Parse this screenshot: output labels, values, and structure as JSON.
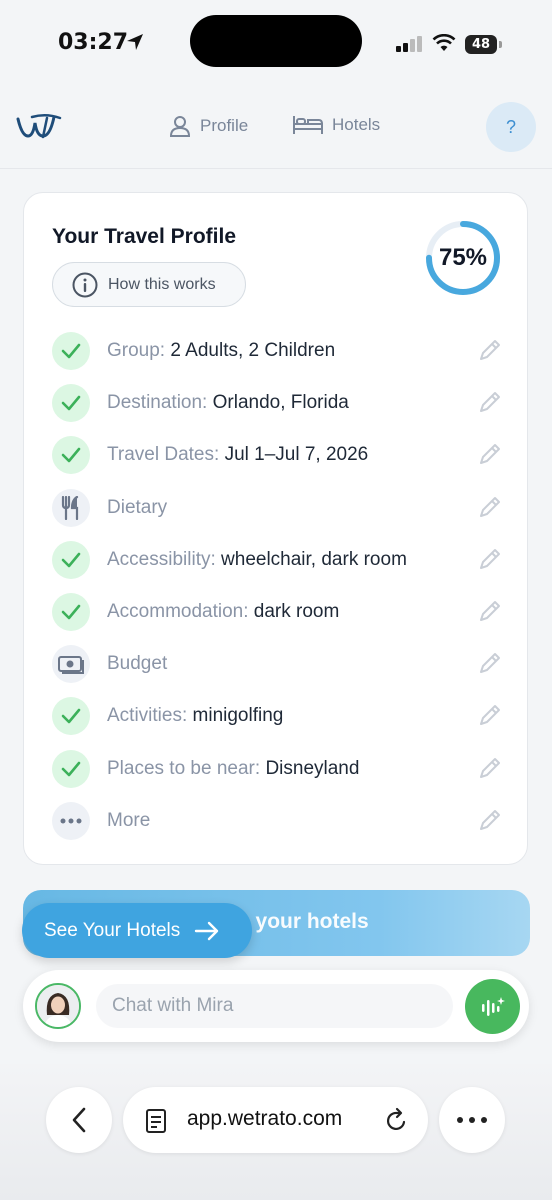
{
  "status": {
    "time": "03:27",
    "battery": "48"
  },
  "nav": {
    "profile_label": "Profile",
    "hotels_label": "Hotels",
    "help_label": "?"
  },
  "profile": {
    "title": "Your Travel Profile",
    "how_label": "How this works",
    "progress_percent": 75,
    "progress_label": "75%",
    "rows": [
      {
        "key": "Group:",
        "value": "2 Adults, 2 Children",
        "done": true,
        "icon": "check-icon"
      },
      {
        "key": "Destination:",
        "value": "Orlando, Florida",
        "done": true,
        "icon": "check-icon"
      },
      {
        "key": "Travel Dates:",
        "value": "Jul 1–Jul 7, 2026",
        "done": true,
        "icon": "check-icon"
      },
      {
        "key": "Dietary",
        "value": "",
        "done": false,
        "icon": "utensils-icon"
      },
      {
        "key": "Accessibility:",
        "value": "wheelchair, dark room",
        "done": true,
        "icon": "check-icon"
      },
      {
        "key": "Accommodation:",
        "value": "dark room",
        "done": true,
        "icon": "check-icon"
      },
      {
        "key": "Budget",
        "value": "",
        "done": false,
        "icon": "money-icon"
      },
      {
        "key": "Activities:",
        "value": "minigolfing",
        "done": true,
        "icon": "check-icon"
      },
      {
        "key": "Places to be near:",
        "value": "Disneyland",
        "done": true,
        "icon": "check-icon"
      },
      {
        "key": "More",
        "value": "",
        "done": false,
        "icon": "more-dots-icon"
      }
    ]
  },
  "cta": {
    "background_label": "e your hotels",
    "button_label": "See Your Hotels"
  },
  "chat": {
    "placeholder": "Chat with Mira"
  },
  "browser": {
    "url": "app.wetrato.com"
  },
  "colors": {
    "accent": "#3fa4e0",
    "success": "#48b85e",
    "check": "#3cb15a"
  }
}
